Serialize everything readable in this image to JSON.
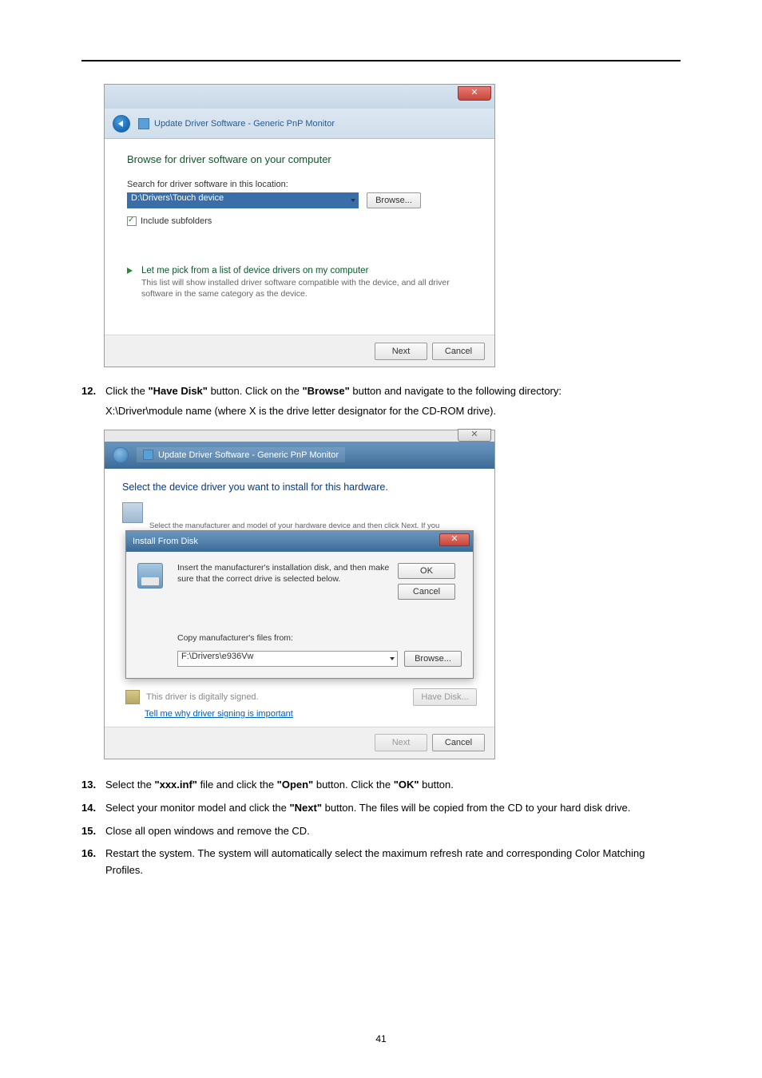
{
  "dialog1": {
    "window_title": "Update Driver Software - Generic PnP Monitor",
    "close_glyph": "✕",
    "heading": "Browse for driver software on your computer",
    "search_label": "Search for driver software in this location:",
    "path_value": "D:\\Drivers\\Touch device",
    "browse_label": "Browse...",
    "checkbox_label": "Include subfolders",
    "option_title": "Let me pick from a list of device drivers on my computer",
    "option_desc": "This list will show installed driver software compatible with the device, and all driver software in the same category as the device.",
    "next_label": "Next",
    "cancel_label": "Cancel"
  },
  "step12": {
    "num": "12.",
    "line1_a": "Click the ",
    "line1_b": "\"Have Disk\"",
    "line1_c": " button. Click on the ",
    "line1_d": "\"Browse\"",
    "line1_e": " button and navigate to the following directory:",
    "line2": "X:\\Driver\\module name (where X is the drive letter designator for the CD-ROM drive)."
  },
  "dialog2": {
    "close_glyph": "✕",
    "window_title": "Update Driver Software - Generic PnP Monitor",
    "heading": "Select the device driver you want to install for this hardware.",
    "partial_line": "Select the manufacturer and model of your hardware device and then click Next. If you",
    "install_title": "Install From Disk",
    "install_close": "✕",
    "install_text1": "Insert the manufacturer's installation disk, and then make sure that the correct drive is selected below.",
    "ok_label": "OK",
    "cancel_label": "Cancel",
    "copy_label": "Copy manufacturer's files from:",
    "copy_value": "F:\\Drivers\\e936Vw",
    "browse_label": "Browse...",
    "signed_text": "This driver is digitally signed.",
    "have_disk_label": "Have Disk...",
    "link_text": "Tell me why driver signing is important",
    "next_label": "Next",
    "footer_cancel_label": "Cancel"
  },
  "step13": {
    "num": "13.",
    "a": "Select the ",
    "b": "\"xxx.inf\"",
    "c": " file and click the ",
    "d": "\"Open\"",
    "e": " button. Click the ",
    "f": "\"OK\"",
    "g": " button."
  },
  "step14": {
    "num": "14.",
    "a": "Select your monitor model and click the ",
    "b": "\"Next\"",
    "c": " button. The files will be copied from the CD to your hard disk drive."
  },
  "step15": {
    "num": "15.",
    "text": "Close all open windows and remove the CD."
  },
  "step16": {
    "num": "16.",
    "text": "Restart the system. The system will automatically select the maximum refresh rate and corresponding Color Matching Profiles."
  },
  "page_number": "41"
}
